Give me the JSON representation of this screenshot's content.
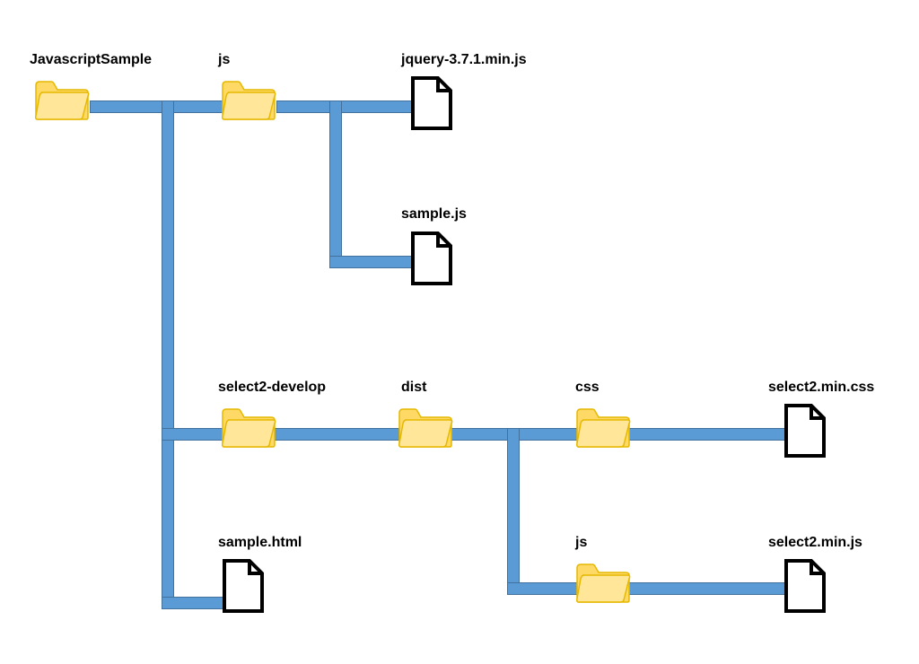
{
  "colors": {
    "connector": "#5b9bd5",
    "connector_border": "#41719c",
    "folder_fill": "#ffd966",
    "folder_stroke": "#e6b800",
    "file_stroke": "#000000"
  },
  "nodes": {
    "root": {
      "label": "JavascriptSample",
      "type": "folder"
    },
    "js": {
      "label": "js",
      "type": "folder"
    },
    "jquery": {
      "label": "jquery-3.7.1.min.js",
      "type": "file"
    },
    "samplejs": {
      "label": "sample.js",
      "type": "file"
    },
    "select2dev": {
      "label": "select2-develop",
      "type": "folder"
    },
    "dist": {
      "label": "dist",
      "type": "folder"
    },
    "css": {
      "label": "css",
      "type": "folder"
    },
    "select2css": {
      "label": "select2.min.css",
      "type": "file"
    },
    "distjs": {
      "label": "js",
      "type": "folder"
    },
    "select2js": {
      "label": "select2.min.js",
      "type": "file"
    },
    "samplehtml": {
      "label": "sample.html",
      "type": "file"
    }
  }
}
